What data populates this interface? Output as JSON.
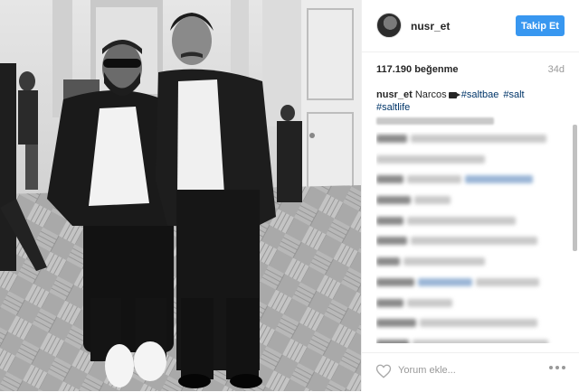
{
  "post": {
    "username": "nusr_et",
    "follow_label": "Takip Et",
    "likes": "117.190 beğenme",
    "age": "34d",
    "caption": {
      "user": "nusr_et",
      "text": "Narcos",
      "icon": "video-camera-icon",
      "hashtags": [
        "#saltbae",
        "#salt",
        "#saltlife"
      ]
    },
    "comment_placeholder": "Yorum ekle...",
    "more_icon": "more-options-icon",
    "like_icon": "heart-icon"
  },
  "colors": {
    "accent": "#3897f0",
    "hashtag": "#003569",
    "muted": "#999999"
  }
}
